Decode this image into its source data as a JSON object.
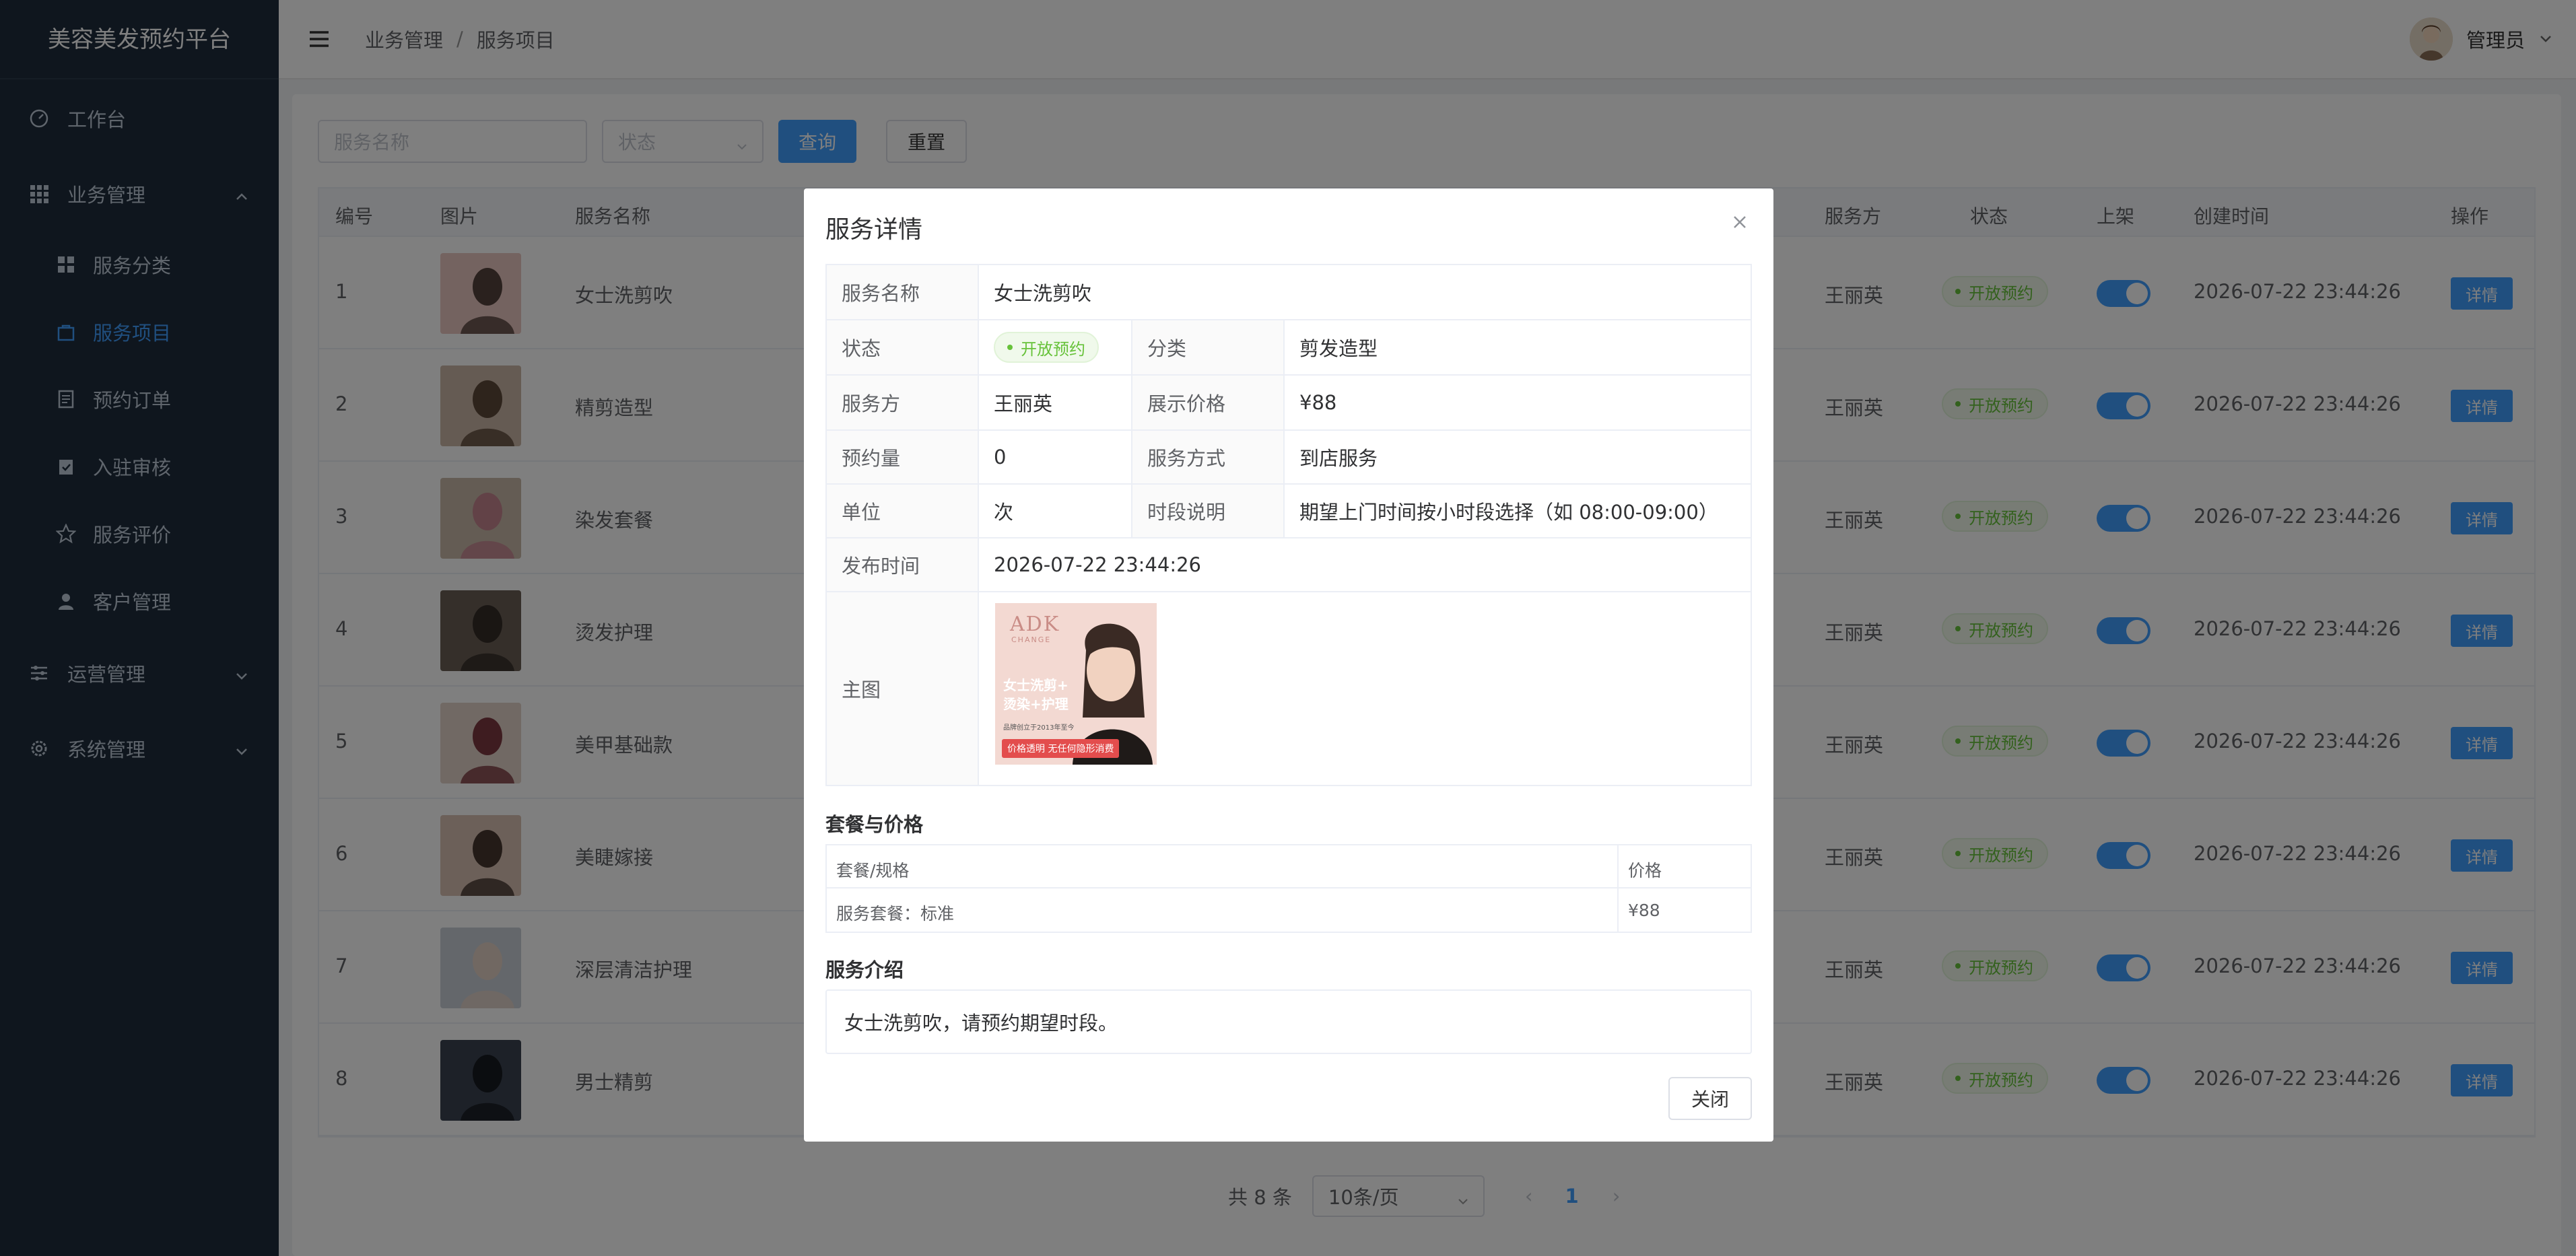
{
  "app": {
    "title": "美容美发预约平台"
  },
  "sidebar": {
    "items": [
      {
        "label": "工作台"
      },
      {
        "label": "业务管理"
      },
      {
        "label": "服务分类"
      },
      {
        "label": "服务项目"
      },
      {
        "label": "预约订单"
      },
      {
        "label": "入驻审核"
      },
      {
        "label": "服务评价"
      },
      {
        "label": "客户管理"
      },
      {
        "label": "运营管理"
      },
      {
        "label": "系统管理"
      }
    ]
  },
  "header": {
    "breadcrumb": [
      "业务管理",
      "服务项目"
    ],
    "separator": "/",
    "user": "管理员"
  },
  "filter": {
    "name_placeholder": "服务名称",
    "status_placeholder": "状态",
    "query_label": "查询",
    "reset_label": "重置"
  },
  "table": {
    "columns": [
      "编号",
      "图片",
      "服务名称",
      "服务方",
      "状态",
      "上架",
      "创建时间",
      "操作"
    ],
    "rows": [
      {
        "id": "1",
        "name": "女士洗剪吹",
        "provider": "王丽英",
        "status": "开放预约",
        "created": "2026-07-22 23:44:26",
        "action": "详情"
      },
      {
        "id": "2",
        "name": "精剪造型",
        "provider": "王丽英",
        "status": "开放预约",
        "created": "2026-07-22 23:44:26",
        "action": "详情"
      },
      {
        "id": "3",
        "name": "染发套餐",
        "provider": "王丽英",
        "status": "开放预约",
        "created": "2026-07-22 23:44:26",
        "action": "详情"
      },
      {
        "id": "4",
        "name": "烫发护理",
        "provider": "王丽英",
        "status": "开放预约",
        "created": "2026-07-22 23:44:26",
        "action": "详情"
      },
      {
        "id": "5",
        "name": "美甲基础款",
        "provider": "王丽英",
        "status": "开放预约",
        "created": "2026-07-22 23:44:26",
        "action": "详情"
      },
      {
        "id": "6",
        "name": "美睫嫁接",
        "provider": "王丽英",
        "status": "开放预约",
        "created": "2026-07-22 23:44:26",
        "action": "详情"
      },
      {
        "id": "7",
        "name": "深层清洁护理",
        "provider": "王丽英",
        "status": "开放预约",
        "created": "2026-07-22 23:44:26",
        "action": "详情"
      },
      {
        "id": "8",
        "name": "男士精剪",
        "provider": "王丽英",
        "status": "开放预约",
        "created": "2026-07-22 23:44:26",
        "action": "详情"
      }
    ]
  },
  "pagination": {
    "total": "共 8 条",
    "page_size": "10条/页",
    "current": "1"
  },
  "dialog": {
    "title": "服务详情",
    "fields": {
      "name_label": "服务名称",
      "name": "女士洗剪吹",
      "status_label": "状态",
      "status": "开放预约",
      "category_label": "分类",
      "category": "剪发造型",
      "provider_label": "服务方",
      "provider": "王丽英",
      "price_label": "展示价格",
      "price": "¥88",
      "bookings_label": "预约量",
      "bookings": "0",
      "mode_label": "服务方式",
      "mode": "到店服务",
      "unit_label": "单位",
      "unit": "次",
      "slot_label": "时段说明",
      "slot": "期望上门时间按小时段选择（如 08:00-09:00）",
      "publish_label": "发布时间",
      "publish": "2026-07-22 23:44:26",
      "image_label": "主图"
    },
    "poster": {
      "brand": "ADK",
      "brand_sub": "CHANGE",
      "headline1": "女士洗剪+",
      "headline2": "烫染+护理",
      "small": "品牌创立于2013年至今",
      "banner": "价格透明 无任何隐形消费"
    },
    "package_title": "套餐与价格",
    "package_headers": [
      "套餐/规格",
      "价格"
    ],
    "packages": [
      {
        "spec": "服务套餐：标准",
        "price": "¥88"
      }
    ],
    "intro_title": "服务介绍",
    "intro": "女士洗剪吹，请预约期望时段。",
    "close_label": "关闭"
  },
  "colors": {
    "accent": "#409eff",
    "sidebar_bg": "#1f2d3d",
    "success": "#67c23a"
  }
}
